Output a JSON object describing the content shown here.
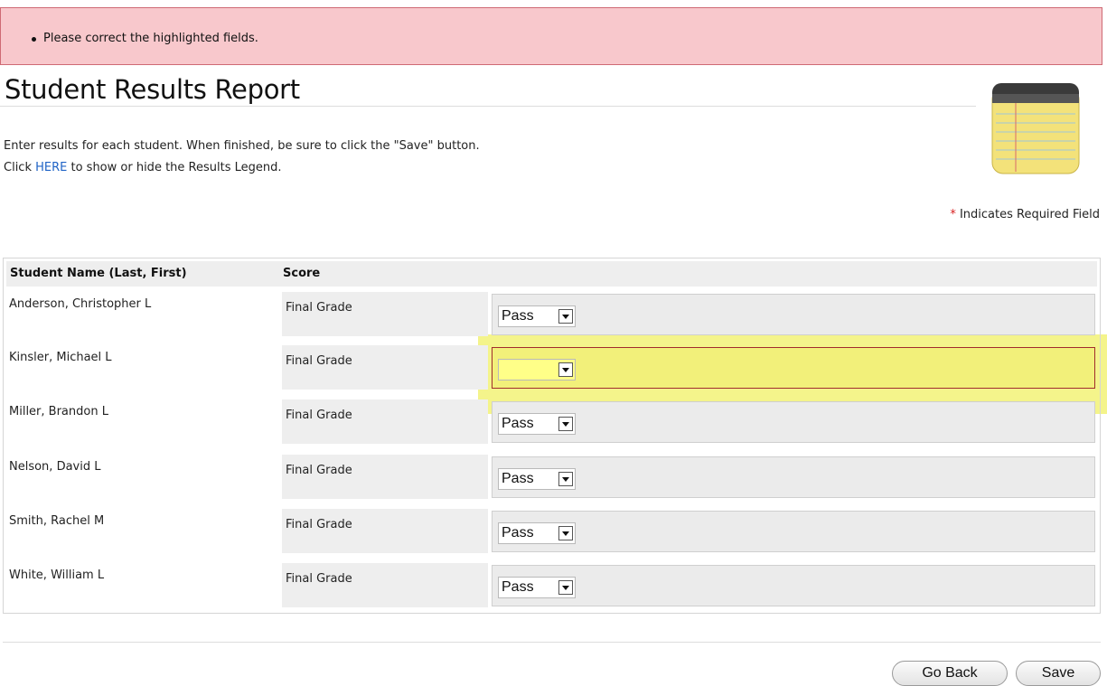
{
  "error": {
    "items": [
      "Please correct the highlighted fields."
    ]
  },
  "title": "Student Results Report",
  "intro": {
    "line1": "Enter results for each student. When finished, be sure to click the \"Save\" button.",
    "line2_prefix": "Click ",
    "line2_link": "HERE",
    "line2_suffix": " to show or hide the Results Legend."
  },
  "required_note": {
    "star": "*",
    "text": " Indicates Required Field"
  },
  "table": {
    "headers": {
      "name": "Student Name (Last, First)",
      "score": "Score"
    },
    "rows": [
      {
        "name": "Anderson, Christopher L",
        "label": "Final Grade",
        "value": "Pass"
      },
      {
        "name": "Kinsler, Michael L",
        "label": "Final Grade",
        "value": ""
      },
      {
        "name": "Miller, Brandon L",
        "label": "Final Grade",
        "value": "Pass"
      },
      {
        "name": "Nelson, David L",
        "label": "Final Grade",
        "value": "Pass"
      },
      {
        "name": "Smith, Rachel M",
        "label": "Final Grade",
        "value": "Pass"
      },
      {
        "name": "White, William L",
        "label": "Final Grade",
        "value": "Pass"
      }
    ]
  },
  "buttons": {
    "back": "Go Back",
    "save": "Save"
  },
  "colors": {
    "error_bg": "#f8c8cc",
    "highlight": "#f0f064",
    "link": "#1f63c6",
    "required_star": "#d82020"
  },
  "icons": {
    "notepad": "notepad-icon",
    "dropdown": "dropdown-arrow-icon"
  }
}
